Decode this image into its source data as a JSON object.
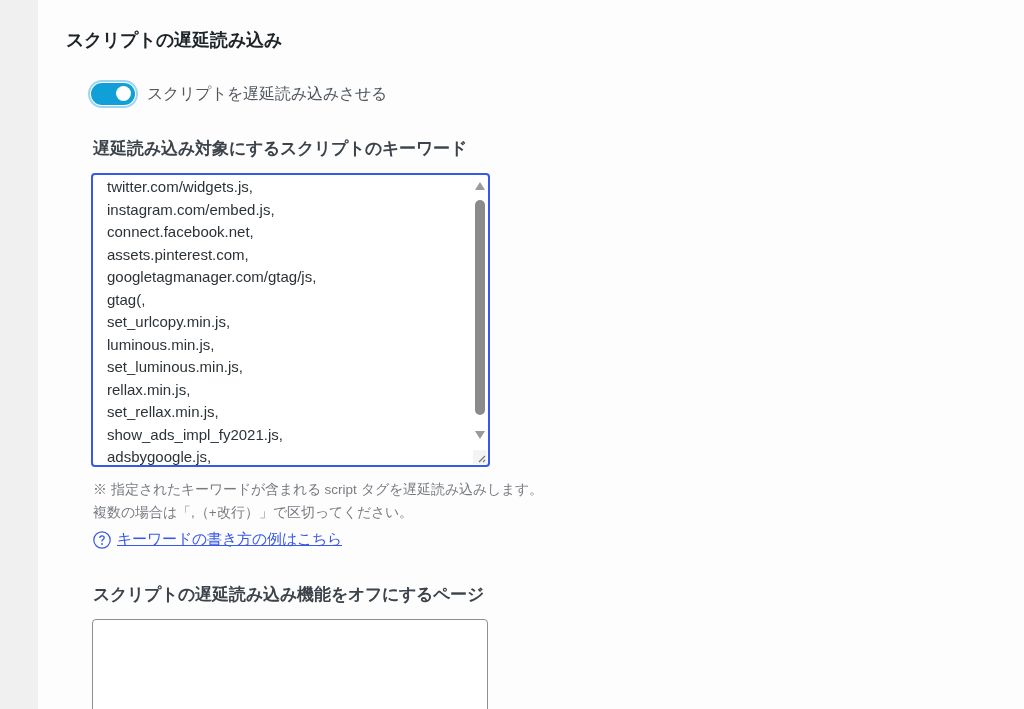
{
  "section": {
    "title": "スクリプトの遅延読み込み",
    "toggle": {
      "label": "スクリプトを遅延読み込みさせる",
      "on": true
    },
    "keywords": {
      "label": "遅延読み込み対象にするスクリプトのキーワード",
      "value": "twitter.com/widgets.js,\ninstagram.com/embed.js,\nconnect.facebook.net,\nassets.pinterest.com,\ngoogletagmanager.com/gtag/js,\ngtag(,\nset_urlcopy.min.js,\nluminous.min.js,\nset_luminous.min.js,\nrellax.min.js,\nset_rellax.min.js,\nshow_ads_impl_fy2021.js,\nadsbygoogle.js,",
      "focused": true,
      "hints": [
        "※ 指定されたキーワードが含まれる script タグを遅延読み込みします。",
        "複数の場合は「,（+改行）」で区切ってください。"
      ],
      "help_link": "キーワードの書き方の例はこちら"
    },
    "excluded_pages": {
      "label": "スクリプトの遅延読み込み機能をオフにするページ",
      "focused": false
    }
  }
}
